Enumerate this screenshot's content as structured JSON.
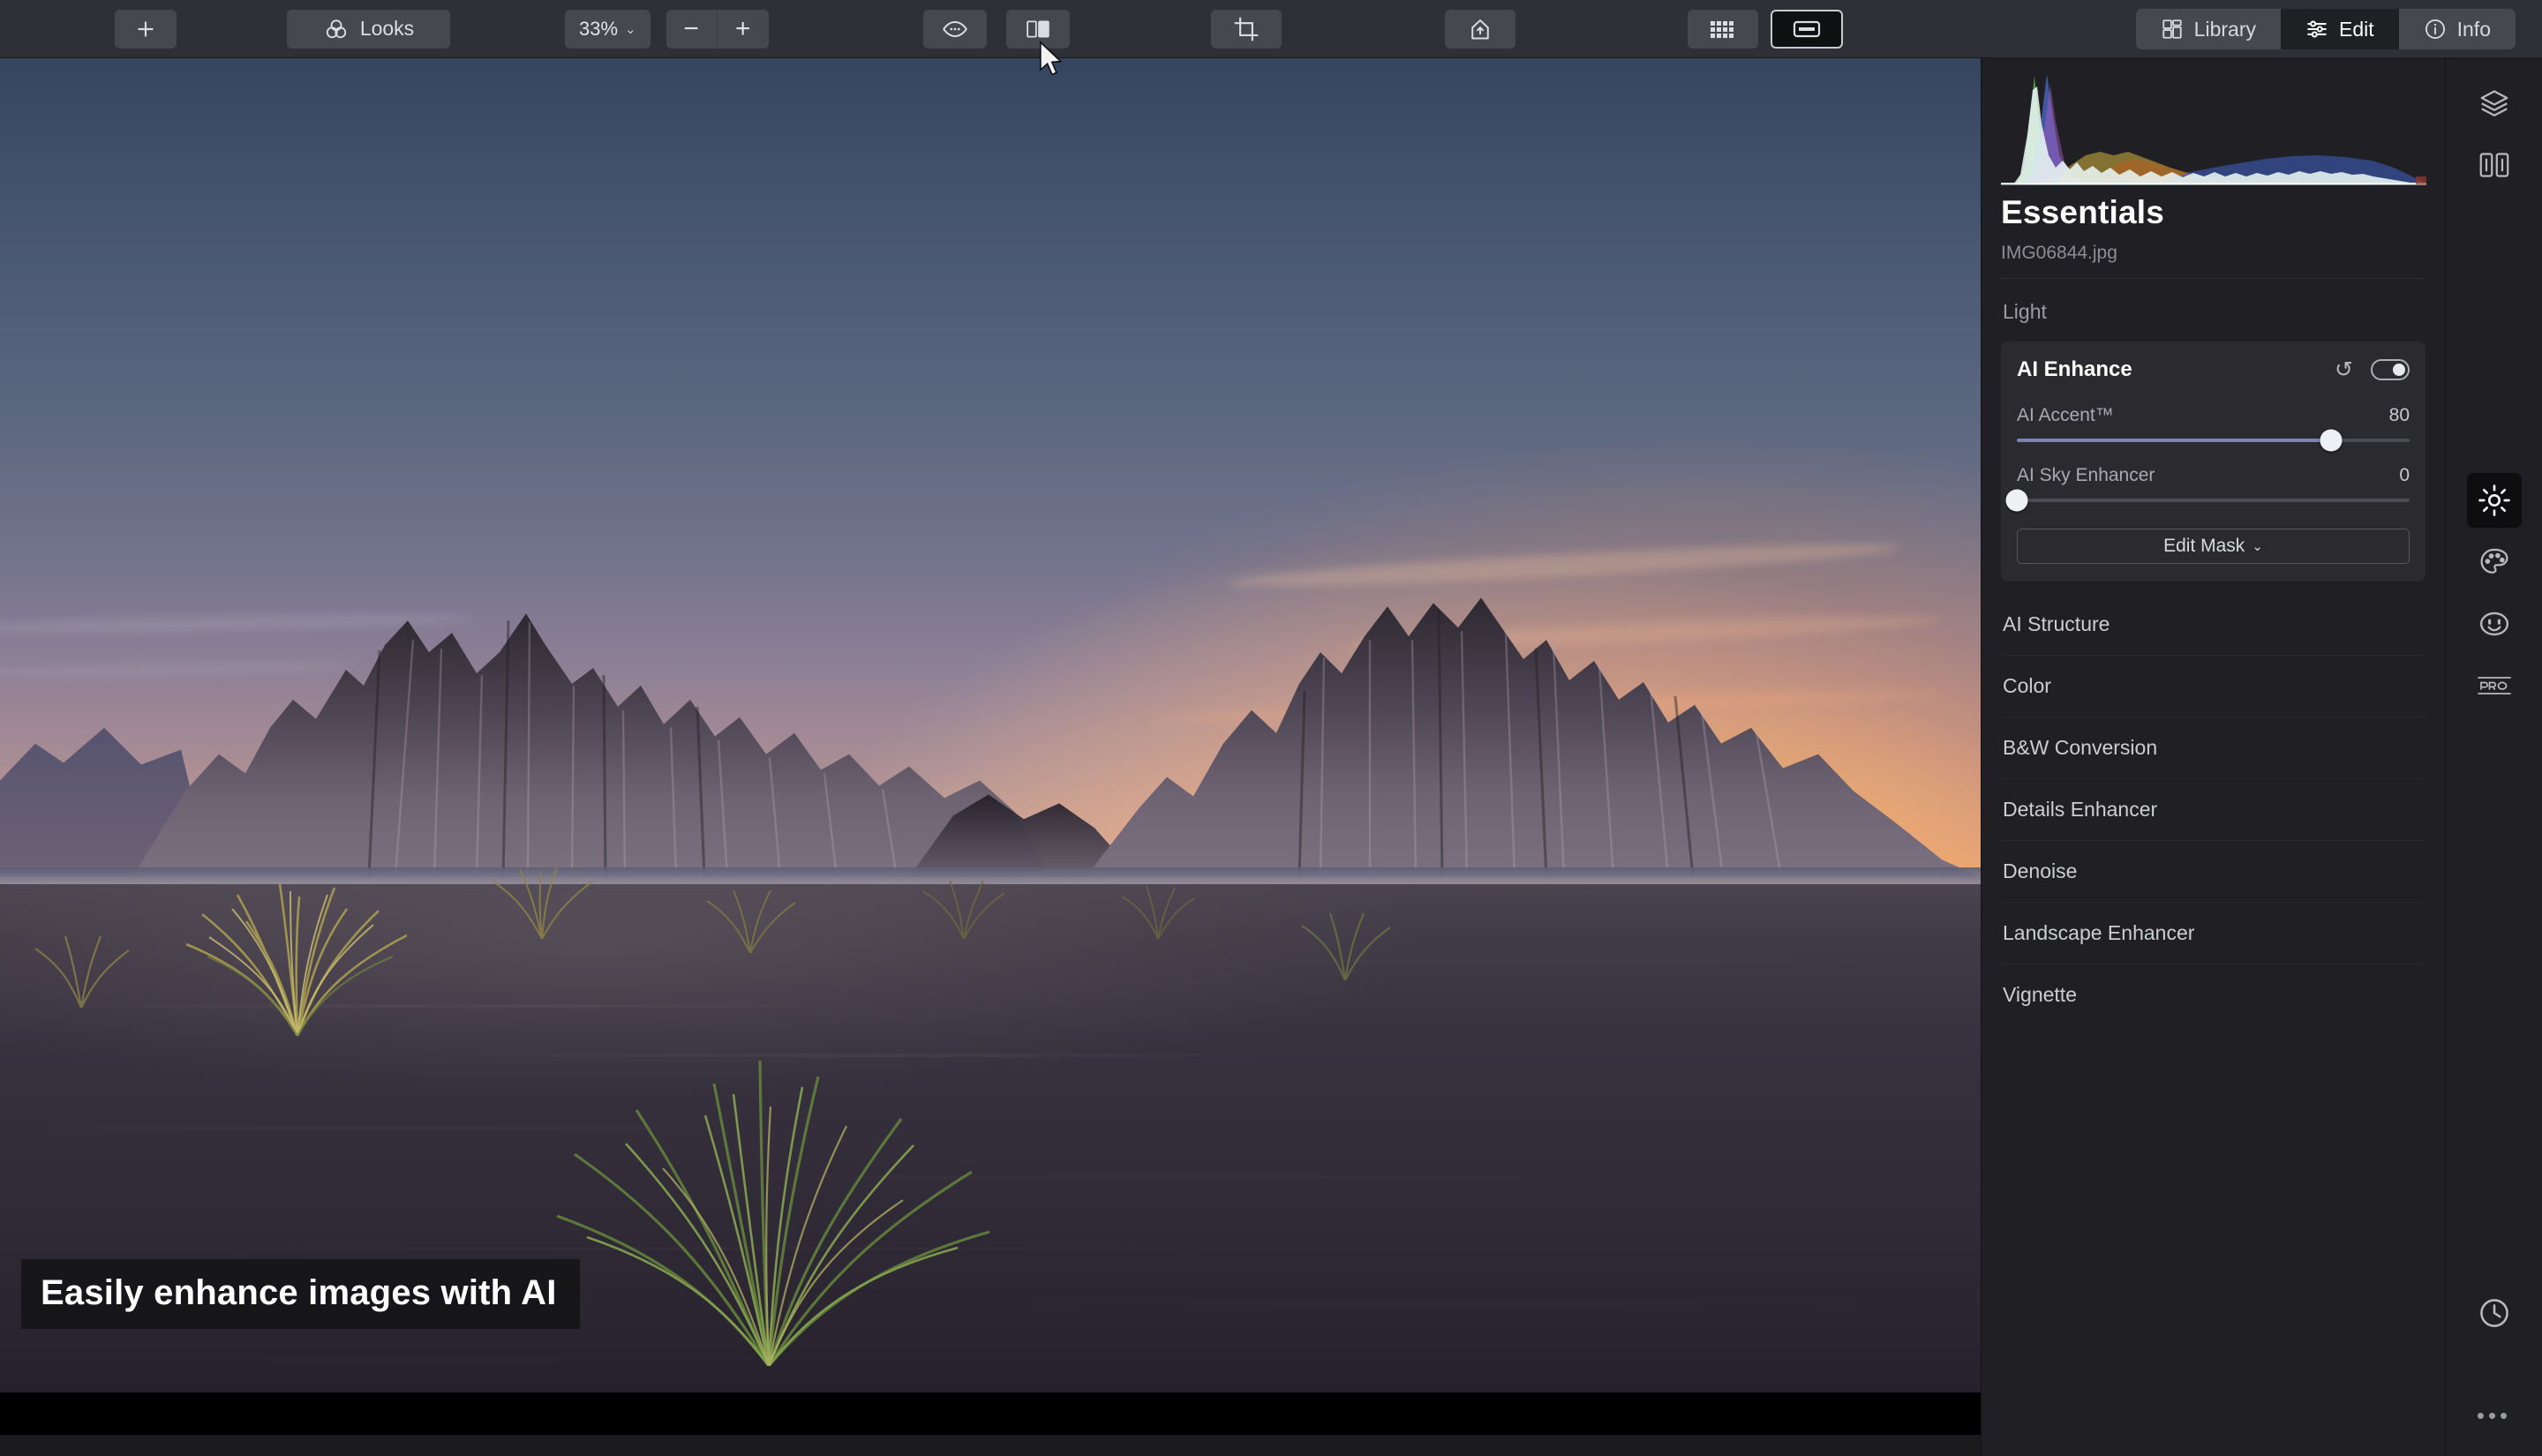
{
  "toolbar": {
    "add_label": "+",
    "looks_label": "Looks",
    "zoom_value": "33%",
    "zoom_chevron": "⌄",
    "zoom_out_label": "−",
    "zoom_in_label": "+",
    "icons": {
      "add": "plus-icon",
      "looks": "looks-icon",
      "preview_eye": "eye-icon",
      "compare": "before-after-compare-icon",
      "crop": "crop-icon",
      "share": "share-export-icon",
      "grid_view": "grid-view-icon",
      "single_view": "single-view-icon"
    }
  },
  "mode_tabs": [
    {
      "label": "Library",
      "icon": "library-photos-icon",
      "active": false
    },
    {
      "label": "Edit",
      "icon": "edit-sliders-icon",
      "active": true
    },
    {
      "label": "Info",
      "icon": "info-circle-icon",
      "active": false
    }
  ],
  "panel": {
    "title": "Essentials",
    "filename": "IMG06844.jpg",
    "section_label": "Light",
    "card": {
      "title": "AI Enhance",
      "reset_icon": "↺",
      "toggle_state": "on",
      "sliders": [
        {
          "name": "AI Accent™",
          "value": "80",
          "percent": 80
        },
        {
          "name": "AI Sky Enhancer",
          "value": "0",
          "percent": 0
        }
      ],
      "mask_button_label": "Edit Mask",
      "mask_button_chevron": "⌄"
    },
    "tools": [
      "AI Structure",
      "Color",
      "B&W Conversion",
      "Details Enhancer",
      "Denoise",
      "Landscape Enhancer",
      "Vignette"
    ]
  },
  "rail": {
    "top_icons": [
      {
        "name": "layers-icon",
        "active": false
      },
      {
        "name": "compare-split-icon",
        "active": false
      }
    ],
    "mid_icons": [
      {
        "name": "essentials-sun-icon",
        "active": true
      },
      {
        "name": "creative-palette-icon",
        "active": false
      },
      {
        "name": "portrait-face-icon",
        "active": false
      },
      {
        "name": "pro-icon",
        "active": false
      }
    ],
    "bottom_icons": [
      {
        "name": "history-clock-icon",
        "active": false
      }
    ],
    "more_label": "•••"
  },
  "canvas": {
    "caption": "Easily enhance images with AI",
    "image_subject": "Vestrahorn mountain at sunset with black sand beach and grass tussocks"
  },
  "colors": {
    "accent_slider": "#7f82b4",
    "panel_bg": "#202024",
    "card_bg": "#2a2a2f",
    "toolbar_bg": "#2e3035",
    "active_tab_bg": "#1f2024"
  }
}
